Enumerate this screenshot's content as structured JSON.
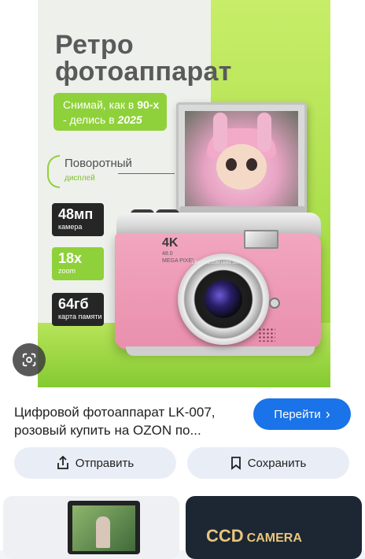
{
  "hero": {
    "title_line1": "Ретро",
    "title_line2": "фотоаппарат",
    "badge_line1_pre": "Снимай, как в ",
    "badge_line1_em": "90-х",
    "badge_line2_pre": "- делись в ",
    "badge_line2_em": "2025",
    "rotating_label": "Поворотный",
    "rotating_sub": "дисплей",
    "specs": [
      {
        "big": "48мп",
        "small": "камера"
      },
      {
        "big": "18x",
        "small": "zoom"
      },
      {
        "big": "64гб",
        "small": "карта памяти"
      }
    ],
    "camera_4k": "4K",
    "camera_mp": "48.0",
    "camera_mp2": "MEGA PIXEL",
    "lens_text": "DIGITAL ZOOM LENS 18X",
    "colors": {
      "accent_green": "#8fd13a",
      "camera_pink": "#f2a6bf"
    }
  },
  "lens_button": {
    "icon": "google-lens-icon"
  },
  "result": {
    "title": "Цифровой фотоаппарат LK-007, розовый купить на OZON по...",
    "go_label": "Перейти",
    "share_label": "Отправить",
    "save_label": "Сохранить",
    "thumb2_text1": "CCD",
    "thumb2_text2": "CAMERA",
    "colors": {
      "primary_blue": "#1a73e8"
    }
  }
}
